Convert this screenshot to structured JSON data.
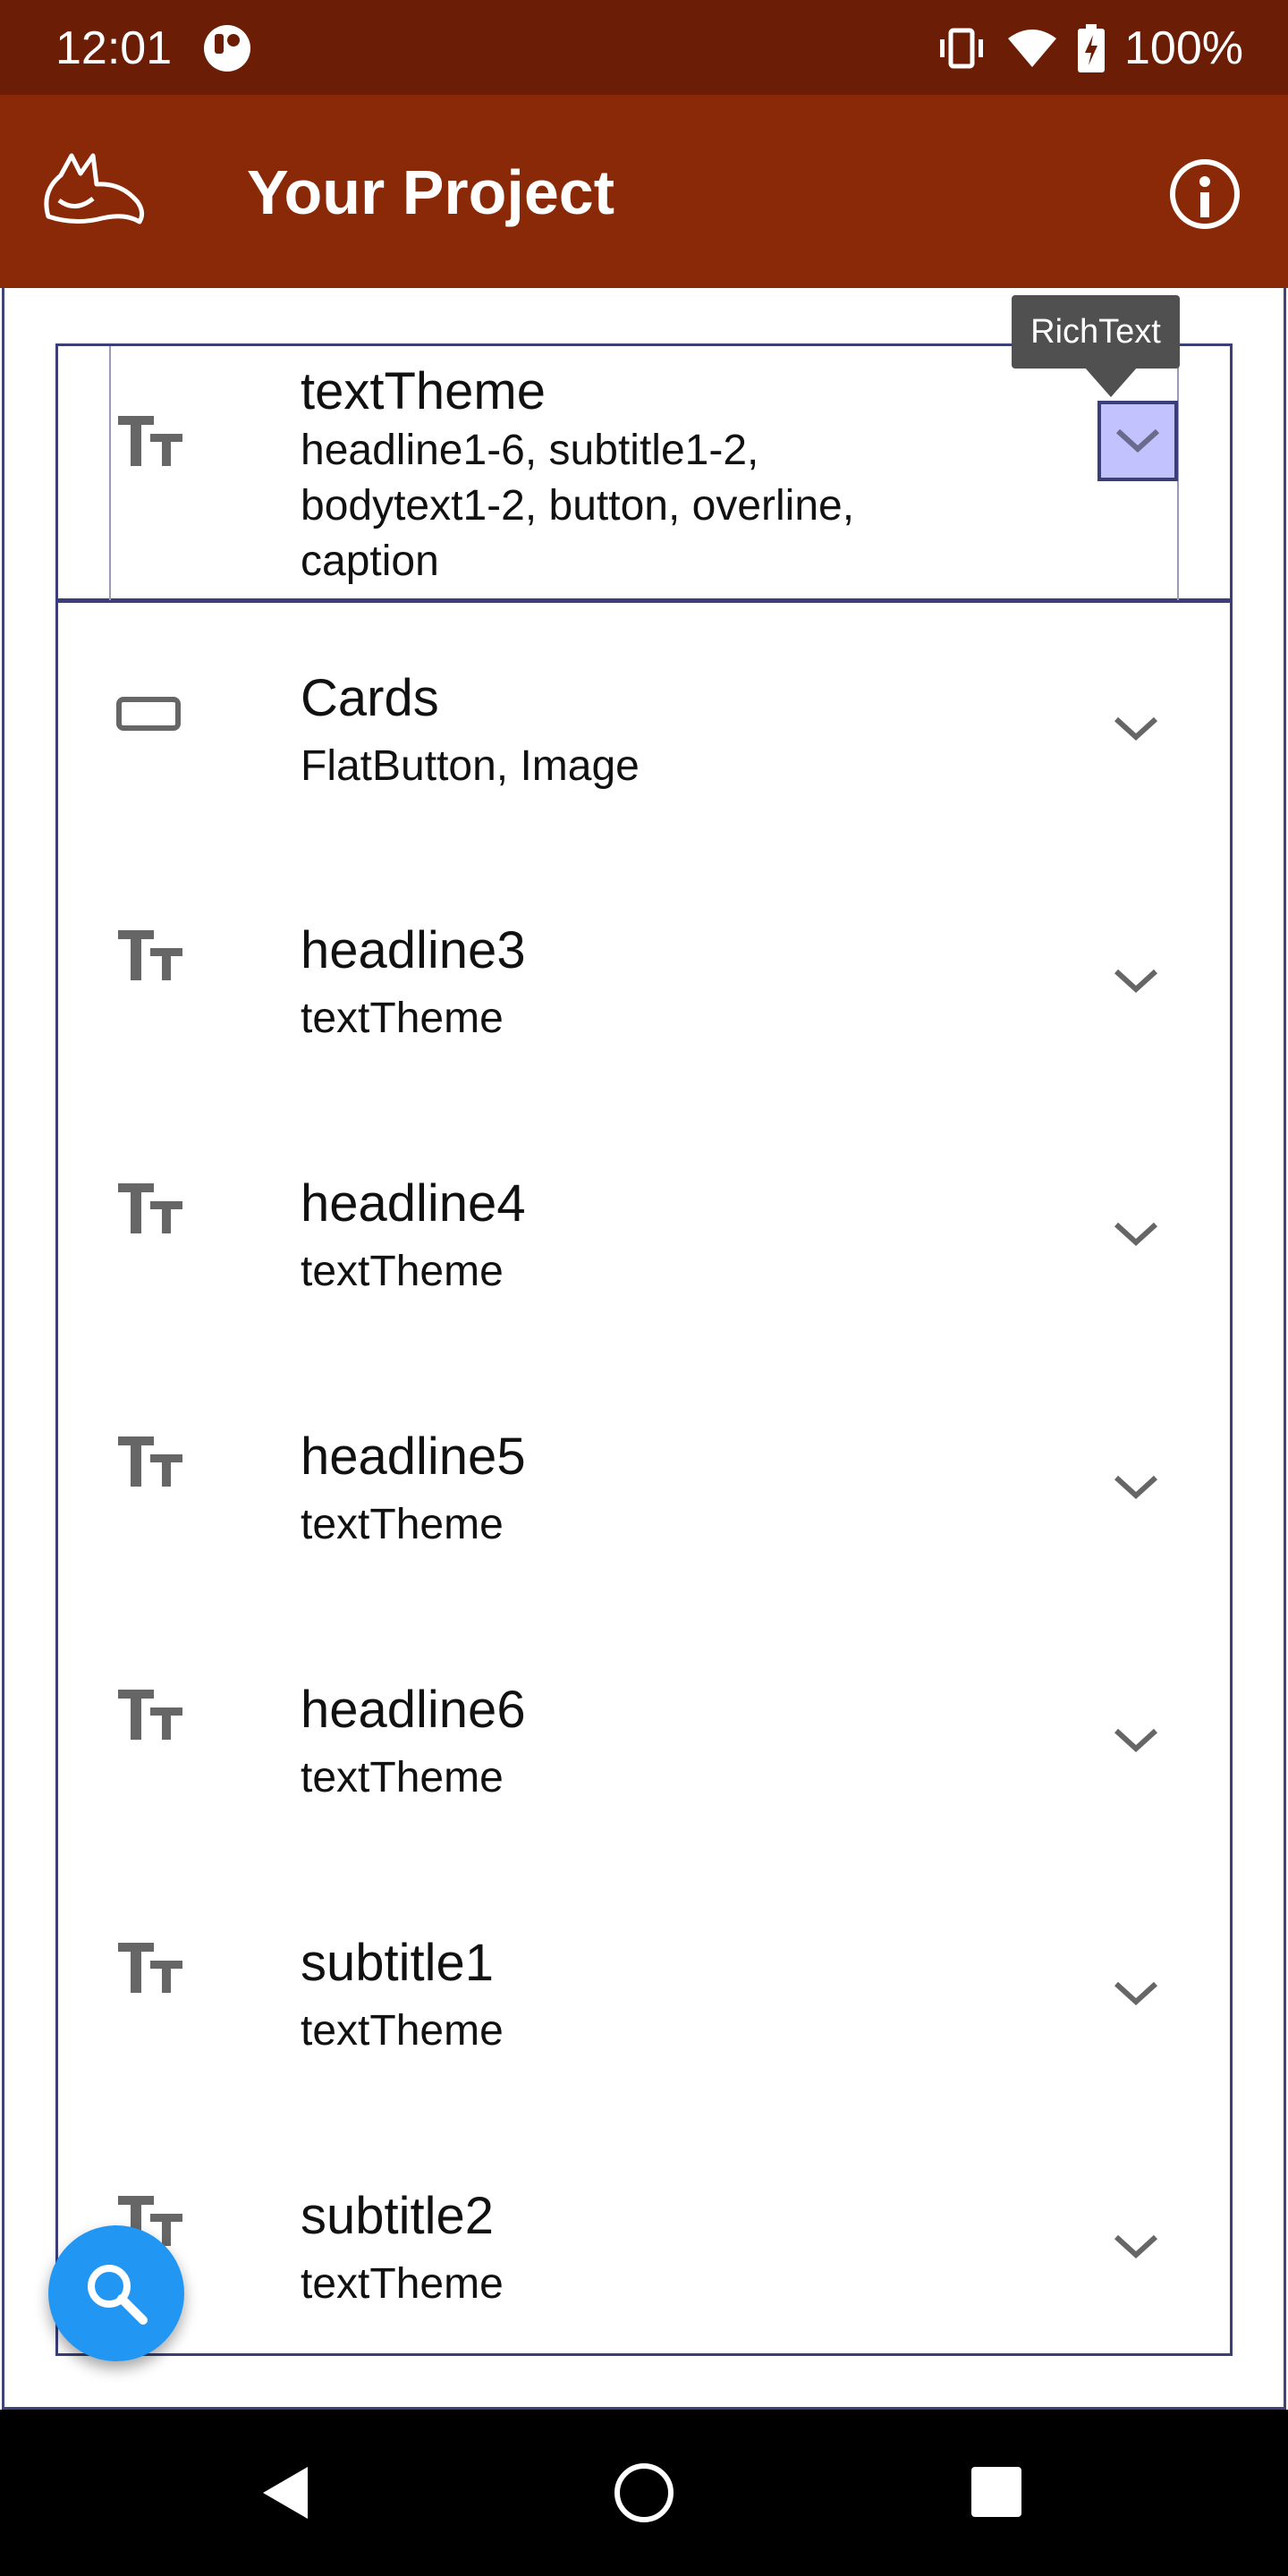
{
  "status_bar": {
    "time": "12:01",
    "battery": "100%",
    "icons": [
      "app-notification-icon",
      "vibrate-icon",
      "wifi-icon",
      "battery-charging-icon"
    ]
  },
  "app_bar": {
    "title": "Your Project",
    "logo": "fox-logo-icon",
    "action_icon": "info-icon"
  },
  "tooltip": {
    "text": "RichText"
  },
  "list": {
    "items": [
      {
        "icon": "text-fields-icon",
        "title": "textTheme",
        "subtitle": "headline1-6, subtitle1-2,\nbodytext1-2, button, overline,\ncaption",
        "highlighted": true
      },
      {
        "icon": "card-icon",
        "title": "Cards",
        "subtitle": "FlatButton, Image"
      },
      {
        "icon": "text-fields-icon",
        "title": "headline3",
        "subtitle": "textTheme"
      },
      {
        "icon": "text-fields-icon",
        "title": "headline4",
        "subtitle": "textTheme"
      },
      {
        "icon": "text-fields-icon",
        "title": "headline5",
        "subtitle": "textTheme"
      },
      {
        "icon": "text-fields-icon",
        "title": "headline6",
        "subtitle": "textTheme"
      },
      {
        "icon": "text-fields-icon",
        "title": "subtitle1",
        "subtitle": "textTheme"
      },
      {
        "icon": "text-fields-icon",
        "title": "subtitle2",
        "subtitle": "textTheme"
      }
    ]
  },
  "fab": {
    "icon": "search-icon"
  },
  "nav_bar": {
    "icons": [
      "back-icon",
      "home-icon",
      "recents-icon"
    ]
  },
  "colors": {
    "status_bar": "#6b1e05",
    "app_bar": "#8a2907",
    "frame_border": "#3a3f78",
    "highlight": "#c2c2ff",
    "fab": "#2196f3"
  }
}
